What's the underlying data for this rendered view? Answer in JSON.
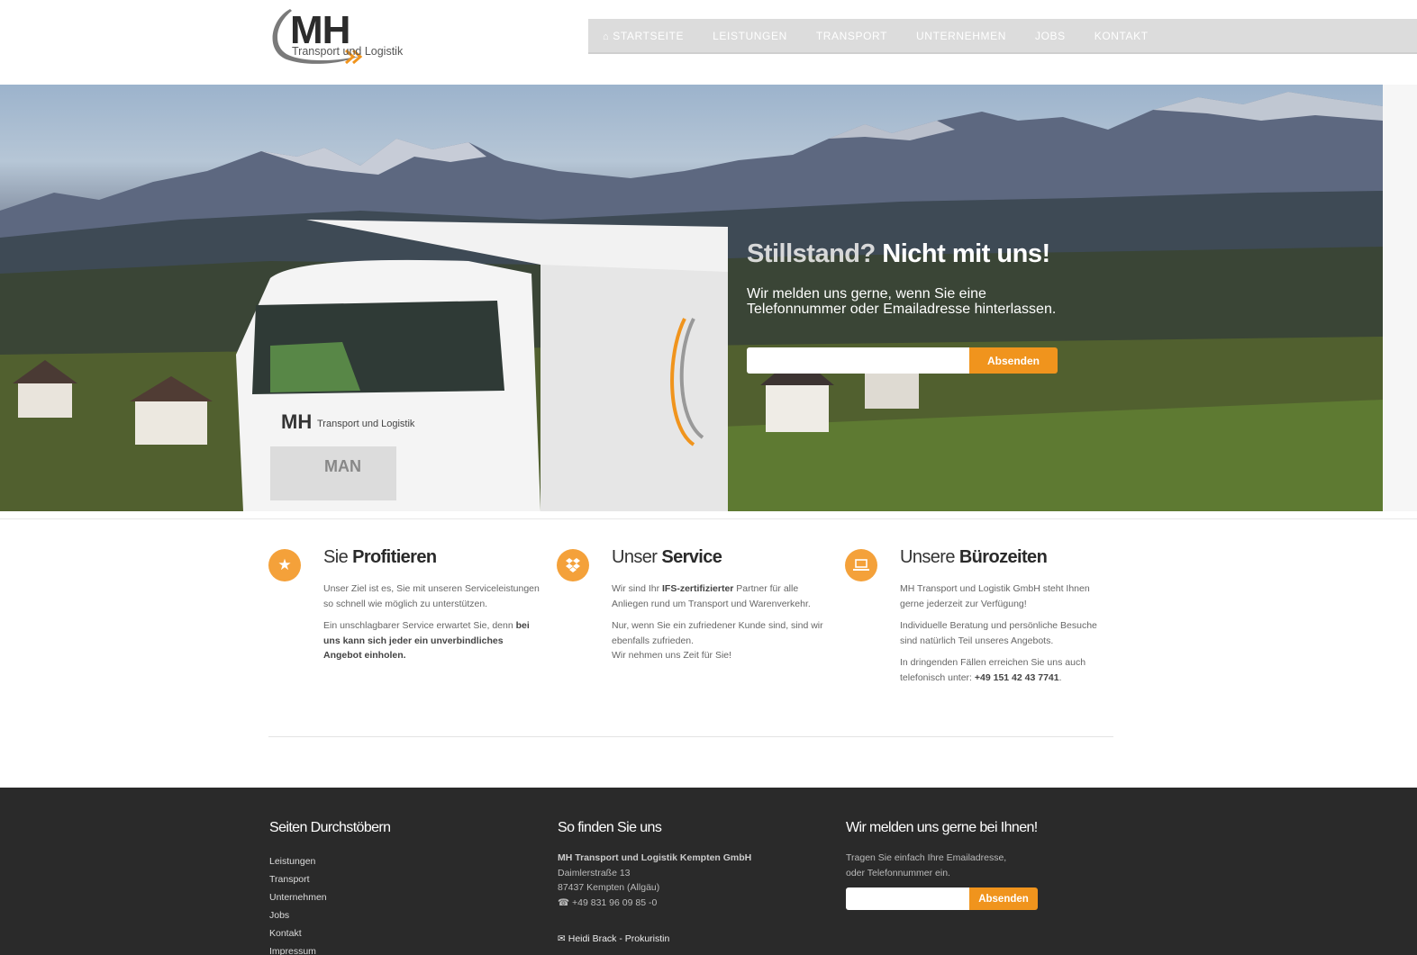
{
  "header": {
    "logo_mark": "MH",
    "logo_subtitle": "Transport und Logistik",
    "nav": [
      {
        "label": "Startseite",
        "icon": "home-icon"
      },
      {
        "label": "Leistungen"
      },
      {
        "label": "Transport"
      },
      {
        "label": "Unternehmen"
      },
      {
        "label": "Jobs"
      },
      {
        "label": "Kontakt"
      }
    ]
  },
  "hero": {
    "title_light": "Stillstand?",
    "title_bold": "Nicht mit uns!",
    "text": "Wir melden uns gerne, wenn Sie eine Telefonnummer oder Emailadresse hinterlassen.",
    "input_value": "",
    "button": "Absenden",
    "truck_logo": "MH",
    "truck_text": "Transport und Logistik",
    "truck_brand": "MAN"
  },
  "features": [
    {
      "icon": "star-icon",
      "title_light": "Sie",
      "title_bold": "Profitieren",
      "p1": "Unser Ziel ist es, Sie mit unseren Serviceleistungen so schnell wie möglich zu unterstützen.",
      "p2_a": "Ein unschlagbarer Service erwartet Sie, denn ",
      "p2_b": "bei uns kann sich jeder ein unverbindliches Angebot einholen."
    },
    {
      "icon": "dropbox-icon",
      "title_light": "Unser",
      "title_bold": "Service",
      "p1_a": "Wir sind Ihr ",
      "p1_b": "IFS-zertifizierter",
      "p1_c": " Partner für alle Anliegen rund um Transport und Warenverkehr.",
      "p2": "Nur, wenn Sie ein zufriedener Kunde sind, sind wir ebenfalls zufrieden.",
      "p3": "Wir nehmen uns Zeit für Sie!"
    },
    {
      "icon": "laptop-icon",
      "title_light": "Unsere",
      "title_bold": "Bürozeiten",
      "p1": "MH Transport und Logistik GmbH steht Ihnen gerne jederzeit zur Verfügung!",
      "p2": "Individuelle Beratung und persönliche Besuche sind natürlich Teil unseres Angebots.",
      "p3_a": "In dringenden Fällen erreichen Sie uns auch telefonisch unter: ",
      "p3_b": "+49 151 42 43 7741",
      "p3_c": "."
    }
  ],
  "footer": {
    "col1": {
      "title": "Seiten Durchstöbern",
      "links": [
        "Leistungen",
        "Transport",
        "Unternehmen",
        "Jobs",
        "Kontakt",
        "Impressum"
      ]
    },
    "col2": {
      "title": "So finden Sie uns",
      "company": "MH Transport und Logistik Kempten GmbH",
      "street": "Daimlerstraße 13",
      "city": "87437 Kempten (Allgäu)",
      "phone": "+49 831 96 09 85 -0",
      "contact": "Heidi Brack - Prokuristin"
    },
    "col3": {
      "title": "Wir melden uns gerne bei Ihnen!",
      "text": "Tragen Sie einfach Ihre Emailadresse, oder Telefonnummer ein.",
      "input_value": "",
      "button": "Absenden"
    }
  },
  "colors": {
    "accent": "#f0941d",
    "nav_bg": "#dcdcdc",
    "footer_bg": "#2a2a2a",
    "icon_circle": "#f4a13a"
  }
}
